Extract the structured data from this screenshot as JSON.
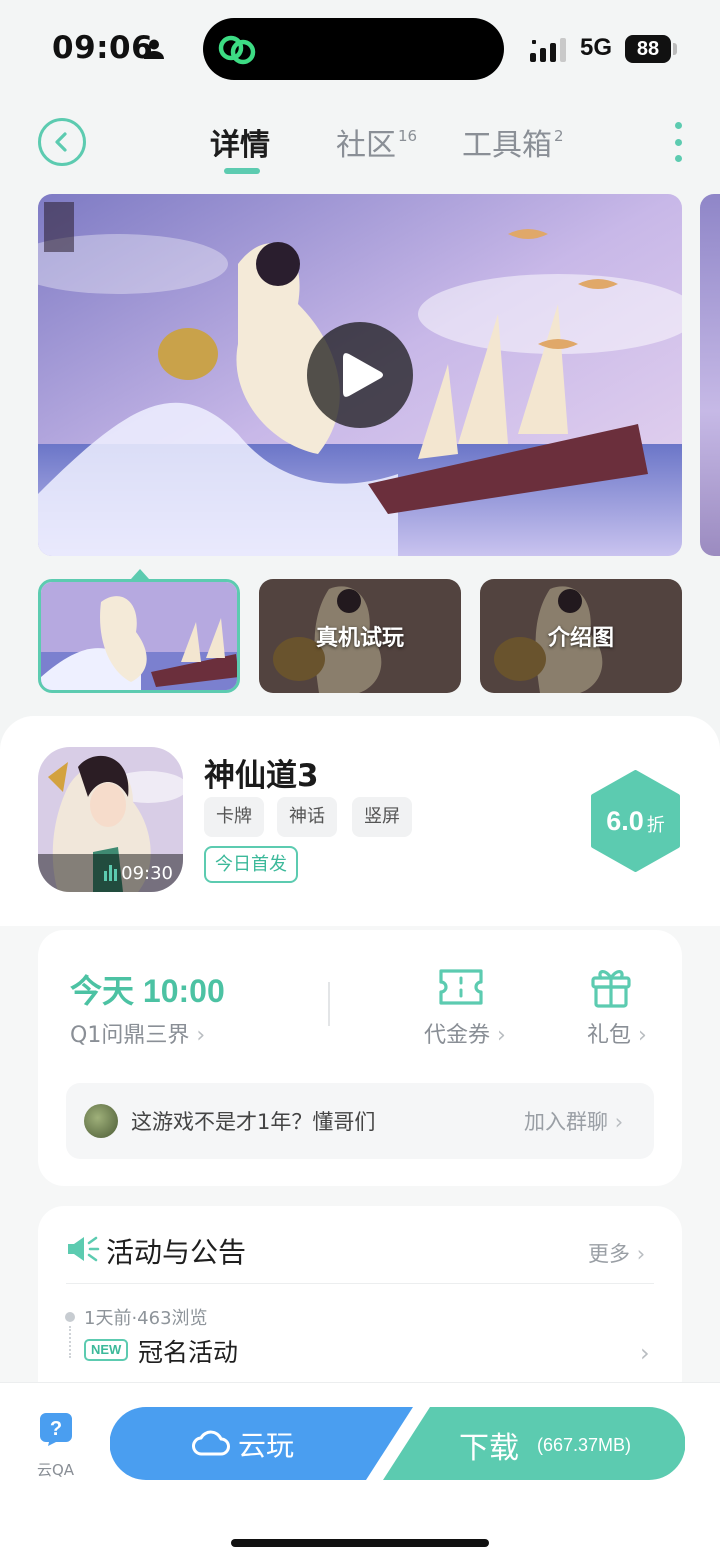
{
  "status_bar": {
    "time": "09:06",
    "network": "5G",
    "battery": "88"
  },
  "nav": {
    "tabs": [
      {
        "label": "详情",
        "badge": ""
      },
      {
        "label": "社区",
        "badge": "16"
      },
      {
        "label": "工具箱",
        "badge": "2"
      }
    ]
  },
  "media": {
    "thumbnails": [
      {
        "label": ""
      },
      {
        "label": "真机试玩"
      },
      {
        "label": "介绍图"
      }
    ]
  },
  "game": {
    "title": "神仙道3",
    "tags": [
      "卡牌",
      "神话",
      "竖屏"
    ],
    "launch_tag": "今日首发",
    "icon_time": "09:30",
    "discount_value": "6.0",
    "discount_unit": "折"
  },
  "server": {
    "open_time": "今天 10:00",
    "name": "Q1问鼎三界",
    "coupon_label": "代金券",
    "gift_label": "礼包"
  },
  "chat": {
    "text": "这游戏不是才1年？懂哥们",
    "join_label": "加入群聊"
  },
  "news": {
    "title": "活动与公告",
    "more_label": "更多",
    "items": [
      {
        "meta": "1天前·463浏览",
        "badge": "NEW",
        "title": "冠名活动"
      }
    ]
  },
  "bottom": {
    "qa_label": "云QA",
    "cloud_play_label": "云玩",
    "download_label": "下载",
    "download_size": "(667.37MB)"
  },
  "colors": {
    "accent": "#5ccbb0",
    "cloud_blue": "#4a9ef0",
    "text_gray": "#8a8f96"
  }
}
